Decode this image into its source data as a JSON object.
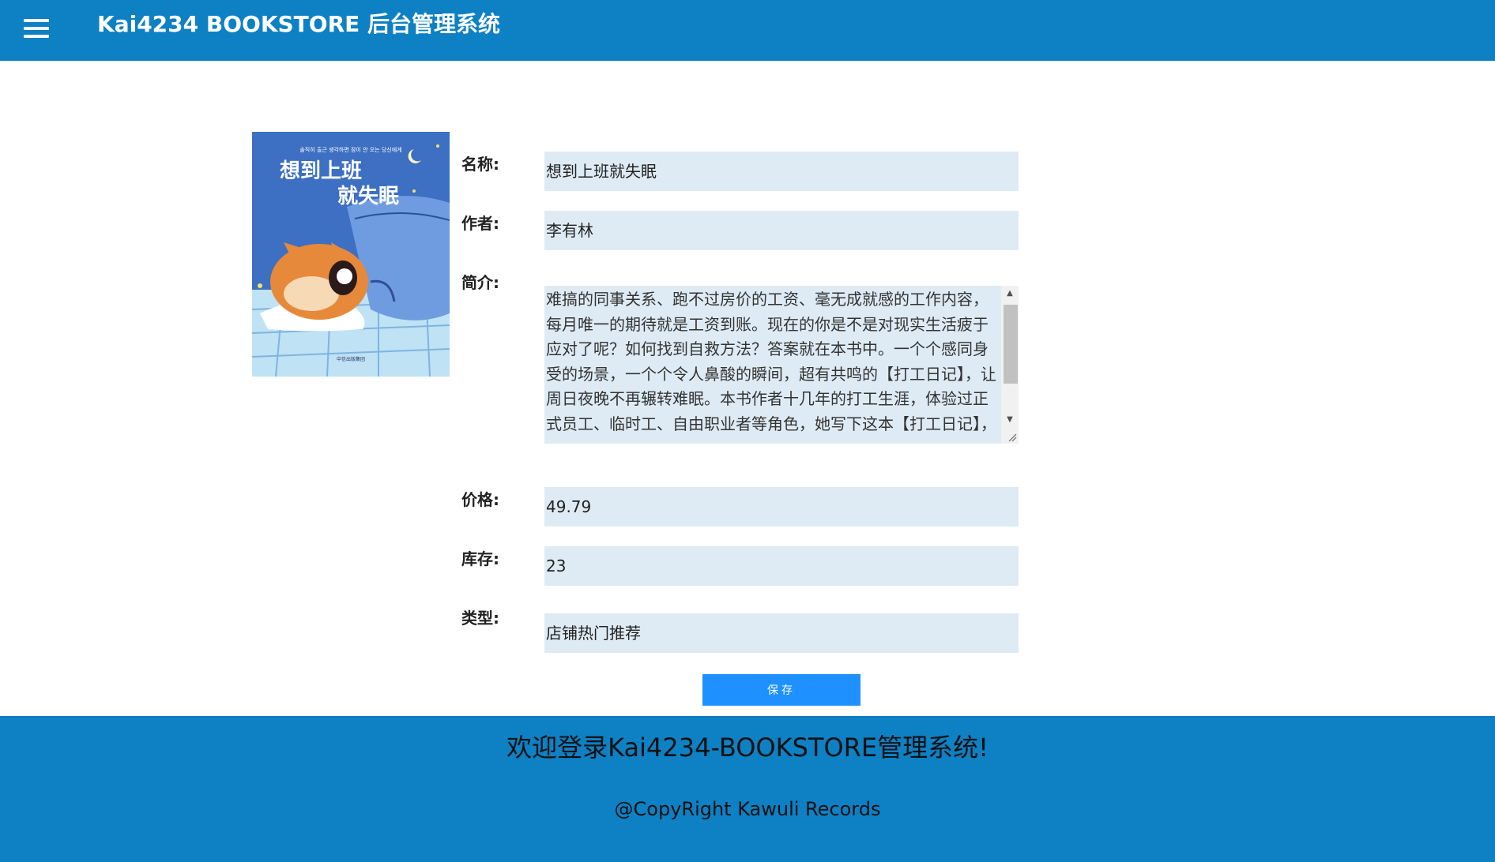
{
  "header": {
    "title": "Kai4234 BOOKSTORE 后台管理系统",
    "menu_icon": "hamburger-menu-icon"
  },
  "book": {
    "cover": {
      "subtitle_korean": "솔직히 출근 생각하면 잠이 안 오는 당신에게",
      "title_line1": "想到上班",
      "title_line2": "就失眠",
      "publisher": "中信出版集团"
    },
    "labels": {
      "name": "名称:",
      "author": "作者:",
      "intro": "简介:",
      "price": "价格:",
      "stock": "库存:",
      "type": "类型:"
    },
    "values": {
      "name": "想到上班就失眠",
      "author": "李有林",
      "intro": "难搞的同事关系、跑不过房价的工资、毫无成就感的工作内容，每月唯一的期待就是工资到账。现在的你是不是对现实生活疲于应对了呢？如何找到自救方法？答案就在本书中。一个个感同身受的场景，一个个令人鼻酸的瞬间，超有共鸣的【打工日记】，让周日夜晚不再辗转难眠。本书作者十几年的打工生涯，体验过正式员工、临时工、自由职业者等角色，她写下这本【打工日记】，",
      "price": "49.79",
      "stock": "23",
      "type": "店铺热门推荐"
    }
  },
  "actions": {
    "save_label": "保存"
  },
  "footer": {
    "welcome": "欢迎登录Kai4234-BOOKSTORE管理系统!",
    "copyright": "@CopyRight Kawuli Records"
  },
  "colors": {
    "brand": "#0e80c4",
    "field_bg": "#deebf5",
    "button": "#1e90ff"
  }
}
